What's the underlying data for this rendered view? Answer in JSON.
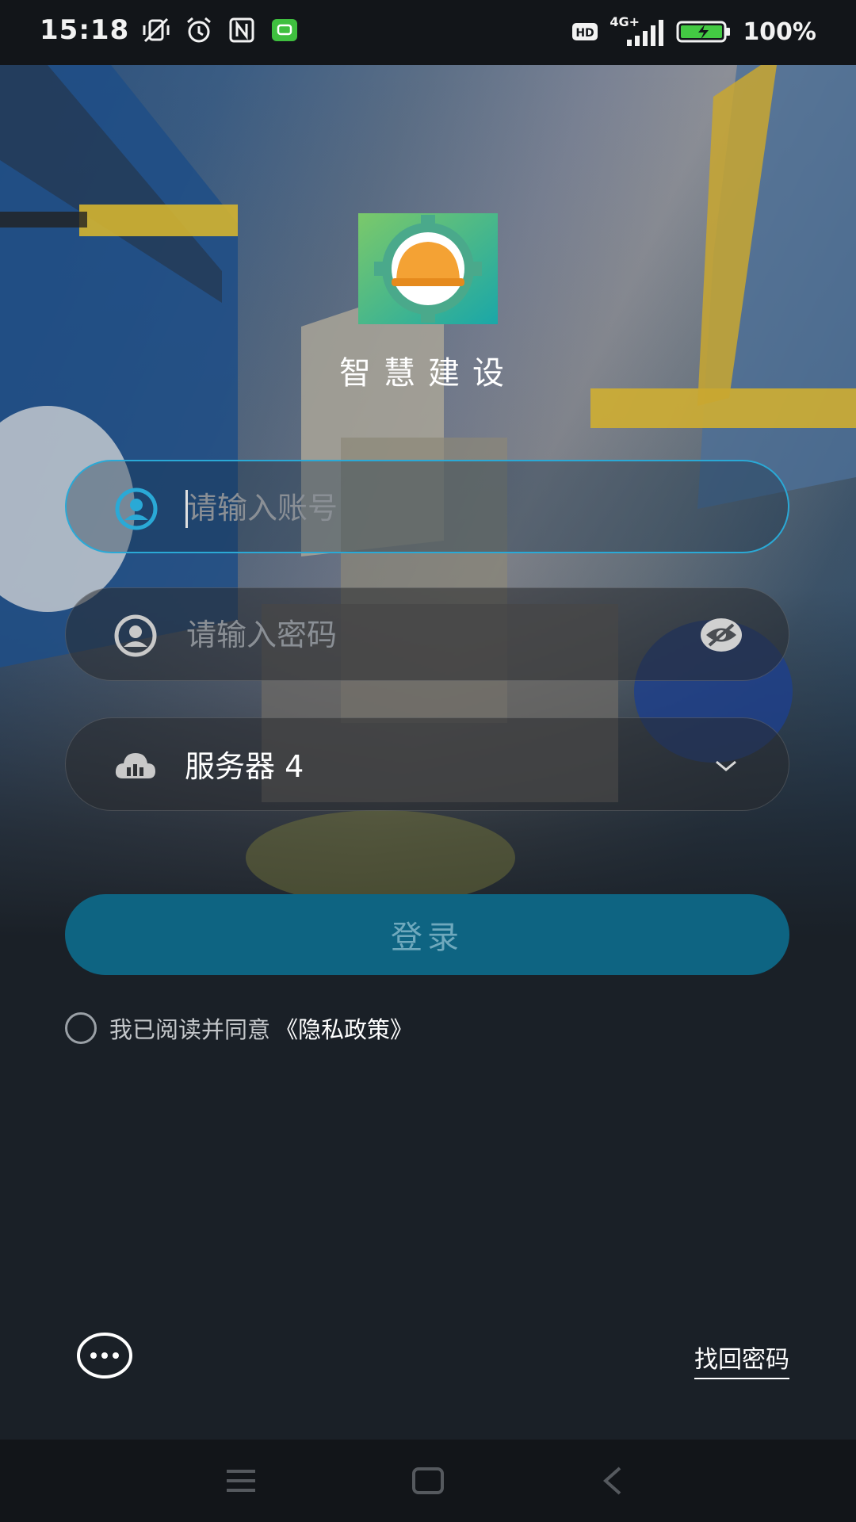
{
  "status_bar": {
    "time": "15:18",
    "battery": "100%",
    "network": "4G+",
    "hd": "HD",
    "icons": [
      "mute-vibrate-icon",
      "alarm-icon",
      "nfc-icon",
      "notification-app-icon",
      "hd-icon",
      "signal-icon",
      "battery-charging-icon"
    ]
  },
  "app": {
    "name": "智慧建设",
    "logo": "hardhat-gear-logo"
  },
  "form": {
    "account_placeholder": "请输入账号",
    "password_placeholder": "请输入密码",
    "server_value": "服务器 4"
  },
  "login_label": "登录",
  "agreement": {
    "text": "我已阅读并同意",
    "link": "《隐私政策》"
  },
  "forgot_password": "找回密码",
  "colors": {
    "accent": "#2aa9d6",
    "login_button": "#0e6482",
    "background": "#1a2027"
  }
}
